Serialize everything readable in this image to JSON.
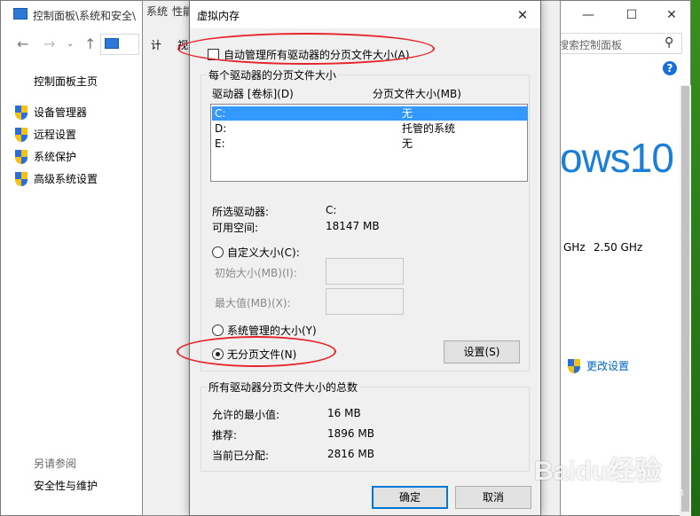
{
  "control_panel": {
    "title": "控制面板\\系统和安全\\",
    "search_placeholder": "搜索控制面板",
    "home": "控制面板主页",
    "side_items": [
      "设备管理器",
      "远程设置",
      "系统保护",
      "高级系统设置"
    ],
    "see_also": "另请参阅",
    "security_maintenance": "安全性与维护",
    "windows_logo": "ows10",
    "cpu_ghz_a": "GHz",
    "cpu_ghz_b": "2.50 GHz",
    "change_settings": "更改设置",
    "help": "?"
  },
  "system_properties": {
    "title_fragment": "系统",
    "perf_fragment": "性能",
    "tab_fragment_a": "计",
    "tab_fragment_b": "视"
  },
  "virtual_memory": {
    "title": "虚拟内存",
    "auto_manage_label": "自动管理所有驱动器的分页文件大小(A)",
    "auto_manage_checked": false,
    "per_drive_group": "每个驱动器的分页文件大小",
    "col_drive": "驱动器 [卷标](D)",
    "col_size": "分页文件大小(MB)",
    "drives": [
      {
        "drive": "C:",
        "size": "无",
        "selected": true
      },
      {
        "drive": "D:",
        "size": "托管的系统",
        "selected": false
      },
      {
        "drive": "E:",
        "size": "无",
        "selected": false
      }
    ],
    "selected_drive_label": "所选驱动器:",
    "selected_drive_value": "C:",
    "free_space_label": "可用空间:",
    "free_space_value": "18147 MB",
    "custom_size_label": "自定义大小(C):",
    "initial_size_label": "初始大小(MB)(I):",
    "max_size_label": "最大值(MB)(X):",
    "system_managed_label": "系统管理的大小(Y)",
    "no_paging_label": "无分页文件(N)",
    "set_button": "设置(S)",
    "totals_group": "所有驱动器分页文件大小的总数",
    "min_allowed_label": "允许的最小值:",
    "min_allowed_value": "16 MB",
    "recommended_label": "推荐:",
    "recommended_value": "1896 MB",
    "allocated_label": "当前已分配:",
    "allocated_value": "2816 MB",
    "ok_button": "确定",
    "cancel_button": "取消",
    "selected_option": "no_paging"
  },
  "watermark": {
    "main": "Baidu经验",
    "sub": "jingyan.baidu.com"
  },
  "colors": {
    "selection": "#3399ff",
    "annotation_red": "#e5252b",
    "link_blue": "#0066cc",
    "win10_blue": "#1a7fd6"
  }
}
